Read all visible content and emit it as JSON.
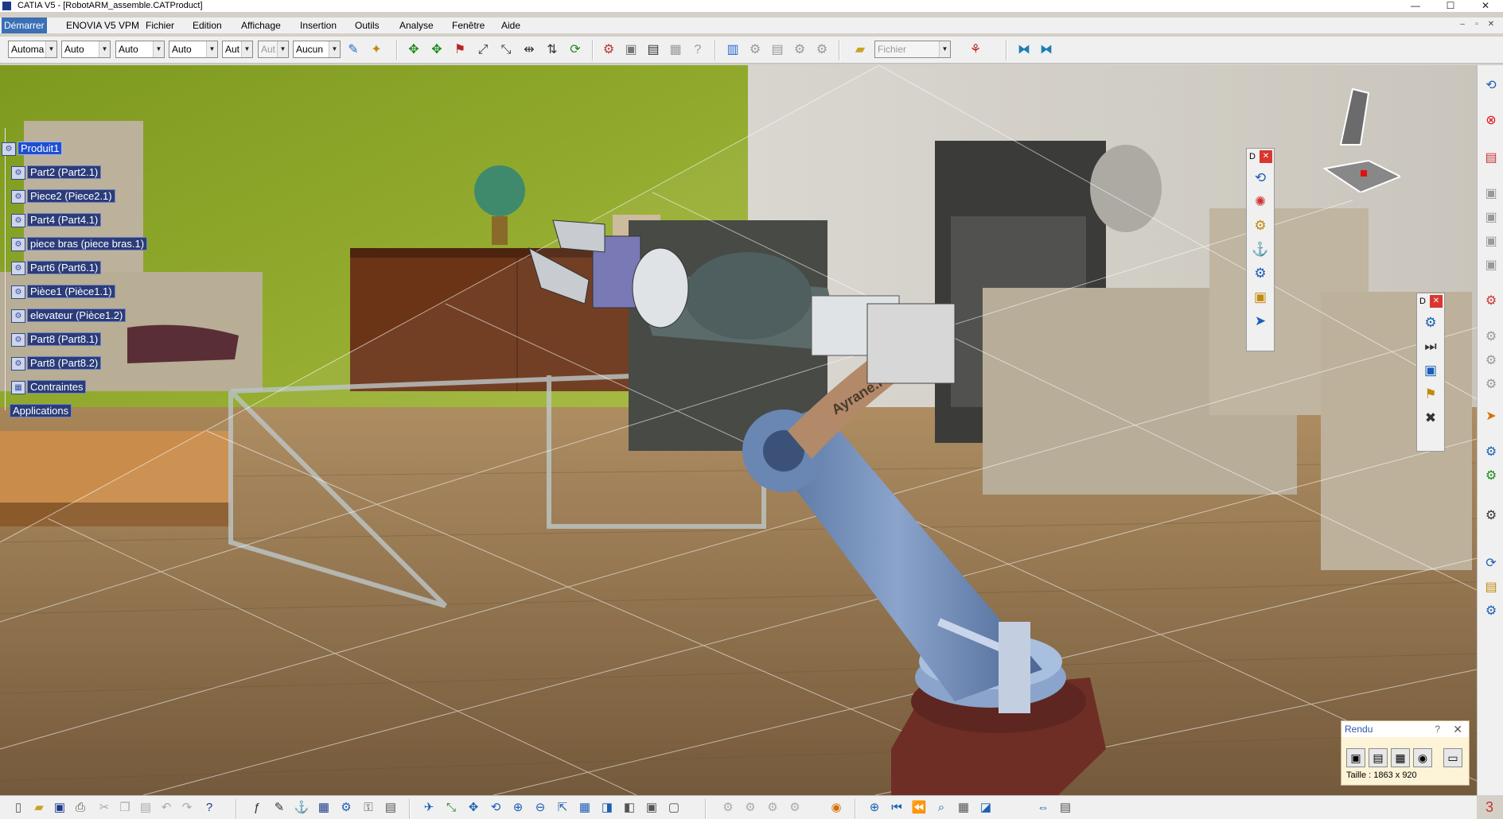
{
  "window": {
    "title": "CATIA V5 - [RobotARM_assemble.CATProduct]",
    "controls": {
      "minimize": "—",
      "maximize": "☐",
      "close": "✕"
    },
    "mdi_controls": {
      "minimize": "–",
      "restore": "▫",
      "close": "✕"
    }
  },
  "menubar": {
    "items": [
      {
        "label": "Démarrer",
        "active": true
      },
      {
        "label": "ENOVIA V5 VPM"
      },
      {
        "label": "Fichier"
      },
      {
        "label": "Edition"
      },
      {
        "label": "Affichage"
      },
      {
        "label": "Insertion"
      },
      {
        "label": "Outils"
      },
      {
        "label": "Analyse"
      },
      {
        "label": "Fenêtre"
      },
      {
        "label": "Aide"
      }
    ]
  },
  "toolbar": {
    "combos": [
      "Automa",
      "Auto",
      "Auto",
      "Auto",
      "Aut",
      "Aut",
      "Aucun"
    ],
    "combo_disabled": [
      false,
      false,
      false,
      false,
      false,
      true,
      false
    ],
    "file_combo_placeholder": "Fichier"
  },
  "spec_tree": {
    "root": "Produit1",
    "children": [
      "Part2 (Part2.1)",
      "Piece2 (Piece2.1)",
      "Part4 (Part4.1)",
      "piece bras (piece bras.1)",
      "Part6 (Part6.1)",
      "Pièce1 (Pièce1.1)",
      "elevateur (Pièce1.2)",
      "Part8 (Part8.1)",
      "Part8 (Part8.2)",
      "Contraintes"
    ],
    "applications": "Applications"
  },
  "model": {
    "engraving": "Ayrane.f"
  },
  "float_toolbar_1": {
    "title": "D"
  },
  "float_toolbar_2": {
    "title": "D"
  },
  "render_panel": {
    "title": "Rendu",
    "help": "?",
    "size_text": "Taille : 1863 x 920"
  },
  "colors": {
    "tree_label_bg": "#2b3c79",
    "tree_selected_bg": "#1f4fd1",
    "menu_active_bg": "#3b6fb6",
    "wall_green": "#8fa82a",
    "floor_wood": "#8a6a3c",
    "robot_blue": "#6a86b3"
  }
}
